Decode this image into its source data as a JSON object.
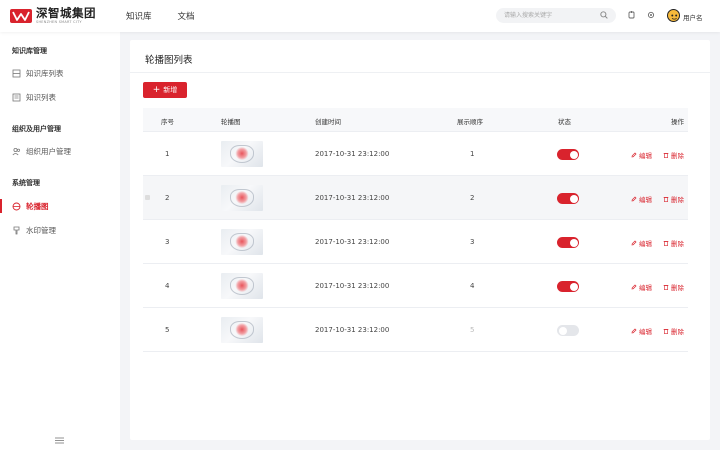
{
  "brand": {
    "name_cn": "深智城集团",
    "name_en": "SHENZHEN SMART CITY",
    "color": "#d9232d"
  },
  "topnav": [
    "知识库",
    "文档"
  ],
  "search": {
    "placeholder": "请输入搜索关键字"
  },
  "user": {
    "name": "用户名"
  },
  "sidebar": {
    "groups": [
      {
        "title": "知识库管理",
        "items": [
          {
            "label": "知识库列表",
            "icon": "library-icon"
          },
          {
            "label": "知识列表",
            "icon": "list-icon"
          }
        ]
      },
      {
        "title": "组织及用户管理",
        "items": [
          {
            "label": "组织用户管理",
            "icon": "users-icon"
          }
        ]
      },
      {
        "title": "系统管理",
        "items": [
          {
            "label": "轮播图",
            "icon": "carousel-icon",
            "active": true
          },
          {
            "label": "水印管理",
            "icon": "stamp-icon"
          }
        ]
      }
    ]
  },
  "page": {
    "title": "轮播图列表",
    "add_button": "新增"
  },
  "table": {
    "headers": [
      "序号",
      "轮播图",
      "创建时间",
      "展示顺序",
      "状态",
      "操作"
    ],
    "rows": [
      {
        "index": "1",
        "created": "2017-10-31   23:12:00",
        "order": "1",
        "enabled": true
      },
      {
        "index": "2",
        "created": "2017-10-31   23:12:00",
        "order": "2",
        "enabled": true
      },
      {
        "index": "3",
        "created": "2017-10-31   23:12:00",
        "order": "3",
        "enabled": true
      },
      {
        "index": "4",
        "created": "2017-10-31   23:12:00",
        "order": "4",
        "enabled": true
      },
      {
        "index": "5",
        "created": "2017-10-31   23:12:00",
        "order": "5",
        "enabled": false
      }
    ],
    "actions": {
      "edit": "编辑",
      "delete": "删除"
    }
  }
}
